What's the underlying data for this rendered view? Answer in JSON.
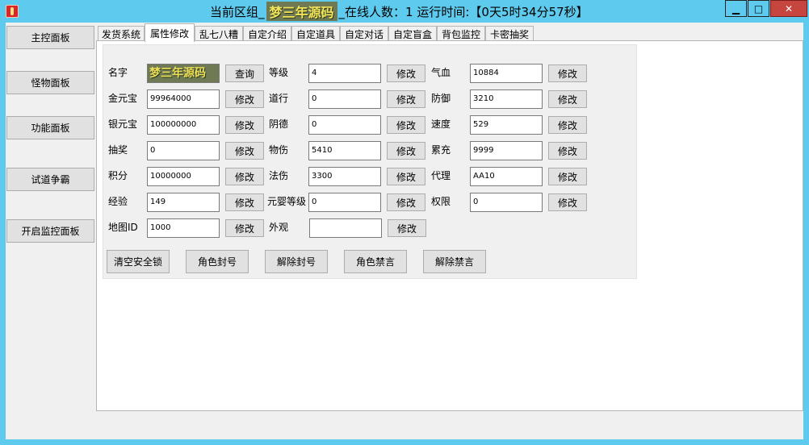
{
  "window": {
    "title_prefix": "当前区组_",
    "title_logo": "梦三年源码",
    "title_suffix": "_在线人数：1  运行时间:【0天5时34分57秒】",
    "minimize_glyph": "▁",
    "maximize_glyph": "□",
    "close_glyph": "✕"
  },
  "sidebar": {
    "items": [
      {
        "label": "主控面板"
      },
      {
        "label": "怪物面板"
      },
      {
        "label": "功能面板"
      },
      {
        "label": "试道争霸"
      },
      {
        "label": "开启监控面板"
      }
    ]
  },
  "tabs": [
    {
      "label": "发货系统"
    },
    {
      "label": "属性修改"
    },
    {
      "label": "乱七八糟"
    },
    {
      "label": "自定介绍"
    },
    {
      "label": "自定道具"
    },
    {
      "label": "自定对话"
    },
    {
      "label": "自定盲盒"
    },
    {
      "label": "背包监控"
    },
    {
      "label": "卡密抽奖"
    }
  ],
  "active_tab": "属性修改",
  "form": {
    "query_label": "查询",
    "modify_label": "修改",
    "col1": [
      {
        "label": "名字",
        "value": "梦三年源码"
      },
      {
        "label": "金元宝",
        "value": "99964000"
      },
      {
        "label": "银元宝",
        "value": "100000000"
      },
      {
        "label": "抽奖",
        "value": "0"
      },
      {
        "label": "积分",
        "value": "10000000"
      },
      {
        "label": "经验",
        "value": "149"
      },
      {
        "label": "地图ID",
        "value": "1000"
      }
    ],
    "col2": [
      {
        "label": "等级",
        "value": "4"
      },
      {
        "label": "道行",
        "value": "0"
      },
      {
        "label": "阴德",
        "value": "0"
      },
      {
        "label": "物伤",
        "value": "5410"
      },
      {
        "label": "法伤",
        "value": "3300"
      },
      {
        "label": "元婴等级",
        "value": "0"
      },
      {
        "label": "外观",
        "value": ""
      }
    ],
    "col3": [
      {
        "label": "气血",
        "value": "10884"
      },
      {
        "label": "防御",
        "value": "3210"
      },
      {
        "label": "速度",
        "value": "529"
      },
      {
        "label": "累充",
        "value": "9999"
      },
      {
        "label": "代理",
        "value": "AA10"
      },
      {
        "label": "权限",
        "value": "0"
      }
    ]
  },
  "actions": [
    {
      "label": "清空安全锁"
    },
    {
      "label": "角色封号"
    },
    {
      "label": "解除封号"
    },
    {
      "label": "角色禁言"
    },
    {
      "label": "解除禁言"
    }
  ],
  "colors": {
    "frame": "#5ecbee",
    "close": "#c7453f",
    "logo_bg": "#6f7a55",
    "logo_fg": "#f4e45a"
  },
  "icons": {
    "app": "app-icon",
    "minimize": "minimize-icon",
    "maximize": "maximize-icon",
    "close": "close-icon"
  }
}
